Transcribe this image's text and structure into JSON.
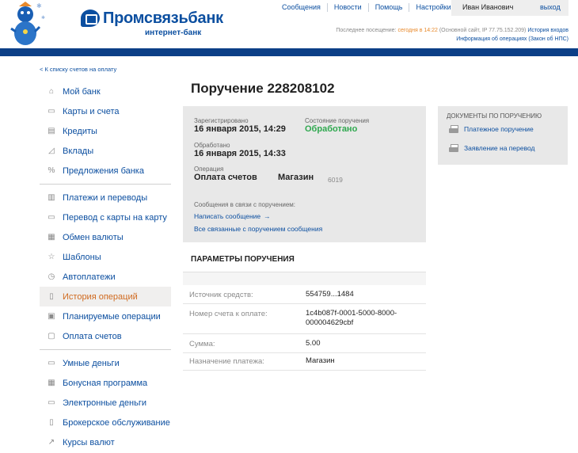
{
  "header": {
    "bank_name": "Промсвязьбанк",
    "bank_sub": "интернет-банк",
    "nav": [
      "Сообщения",
      "Новости",
      "Помощь",
      "Настройки"
    ],
    "user_name": "Иван Иванович",
    "logout": "выход",
    "last_visit_prefix": "Последнее посещение:",
    "last_visit_time": "сегодня в 14:22",
    "last_visit_suffix": "(Основной сайт, IP 77.75.152.209)",
    "login_history": "История входов",
    "operations_info": "Информация об операциях (Закон об НПС)"
  },
  "sidebar": {
    "back_link": "< К списку счетов на оплату",
    "groups": [
      [
        {
          "label": "Мой банк",
          "icon": "home-icon"
        },
        {
          "label": "Карты и счета",
          "icon": "card-icon"
        },
        {
          "label": "Кредиты",
          "icon": "credit-icon"
        },
        {
          "label": "Вклады",
          "icon": "chart-icon"
        },
        {
          "label": "Предложения банка",
          "icon": "percent-icon"
        }
      ],
      [
        {
          "label": "Платежи и переводы",
          "icon": "payments-icon"
        },
        {
          "label": "Перевод с карты на карту",
          "icon": "card-transfer-icon"
        },
        {
          "label": "Обмен валюты",
          "icon": "exchange-icon"
        },
        {
          "label": "Шаблоны",
          "icon": "star-icon"
        },
        {
          "label": "Автоплатежи",
          "icon": "clock-icon"
        },
        {
          "label": "История операций",
          "icon": "document-icon",
          "active": true
        },
        {
          "label": "Планируемые операции",
          "icon": "calendar-icon"
        },
        {
          "label": "Оплата счетов",
          "icon": "invoice-icon"
        }
      ],
      [
        {
          "label": "Умные деньги",
          "icon": "wallet-icon"
        },
        {
          "label": "Бонусная программа",
          "icon": "gift-icon"
        },
        {
          "label": "Электронные деньги",
          "icon": "emoney-icon"
        },
        {
          "label": "Брокерское обслуживание",
          "icon": "broker-icon"
        },
        {
          "label": "Курсы валют",
          "icon": "rates-icon"
        }
      ]
    ]
  },
  "order": {
    "title": "Поручение 228208102",
    "registered_label": "Зарегистрировано",
    "registered_value": "16 января 2015, 14:29",
    "status_label": "Состояние поручения",
    "status_value": "Обработано",
    "processed_label": "Обработано",
    "processed_value": "16 января 2015, 14:33",
    "operation_label": "Операция",
    "operation_value": "Оплата счетов",
    "operation_merchant": "Магазин",
    "operation_code": "6019",
    "messages_label": "Сообщения в связи с поручением:",
    "write_message": "Написать сообщение",
    "all_messages": "Все связанные с поручением сообщения"
  },
  "params": {
    "title": "ПАРАМЕТРЫ ПОРУЧЕНИЯ",
    "rows": [
      {
        "label": "Источник средств:",
        "value": "554759...1484"
      },
      {
        "label": "Номер счета к оплате:",
        "value": "1c4b087f-0001-5000-8000-000004629cbf"
      },
      {
        "label": "Сумма:",
        "value": "5.00"
      },
      {
        "label": "Назначение платежа:",
        "value": "Магазин"
      }
    ]
  },
  "docs": {
    "title": "ДОКУМЕНТЫ ПО ПОРУЧЕНИЮ",
    "items": [
      "Платежное поручение",
      "Заявление на перевод"
    ]
  },
  "colors": {
    "brand_blue": "#0c4fa0",
    "header_bar": "#0c3f87",
    "status_green": "#2fa84f",
    "active_orange": "#d06a1f"
  }
}
